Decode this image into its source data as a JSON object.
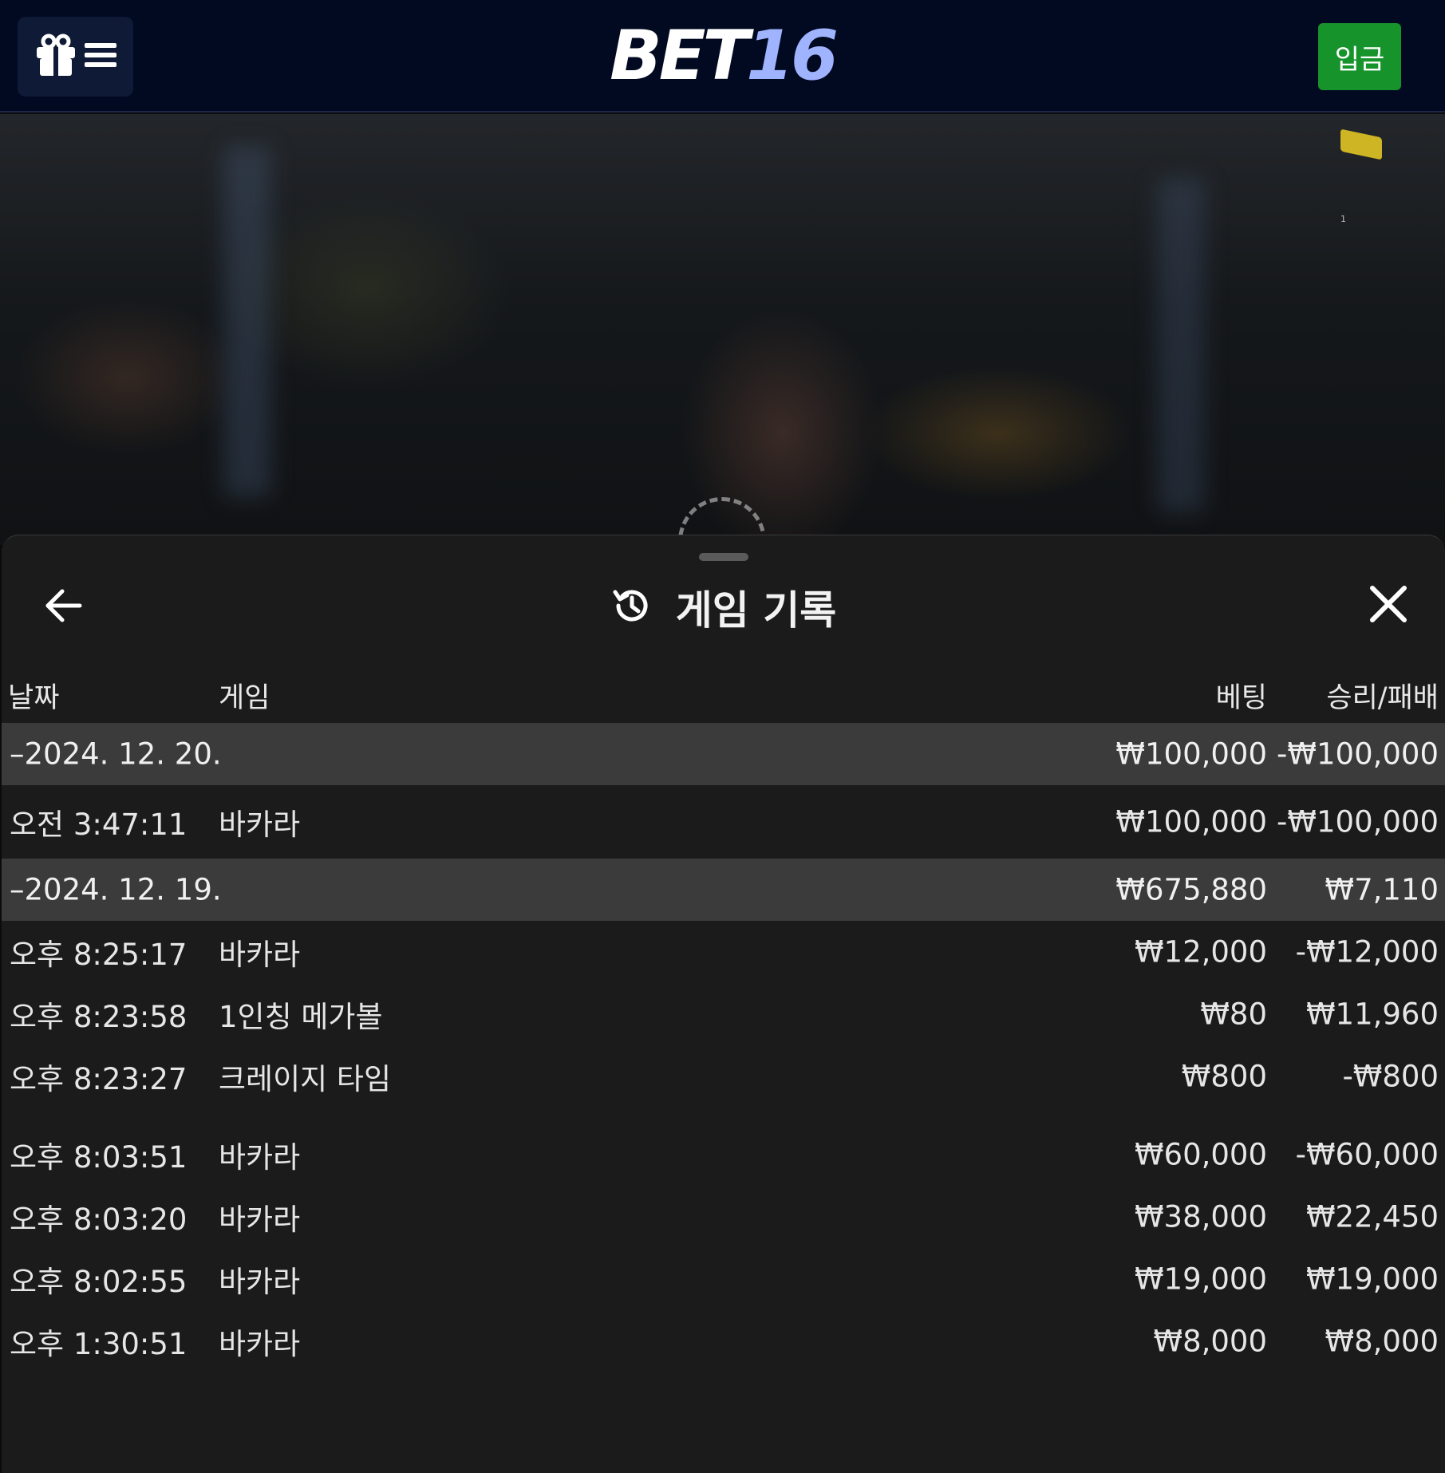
{
  "header": {
    "logo_part1": "BET",
    "logo_part2": "16",
    "deposit_label": "입금",
    "accent_green": "#17932c",
    "logo_accent": "#9fb3ff"
  },
  "video": {
    "corner_mark": "1"
  },
  "sheet": {
    "title": "게임 기록",
    "columns": {
      "date": "날짜",
      "game": "게임",
      "bet": "베팅",
      "result": "승리/패배"
    },
    "groups": [
      {
        "date": "–2024. 12. 20.",
        "bet": "₩100,000",
        "result": "-₩100,000",
        "entries": [
          {
            "time": "오전 3:47:11",
            "game": "바카라",
            "bet": "₩100,000",
            "result": "-₩100,000"
          }
        ]
      },
      {
        "date": "–2024. 12. 19.",
        "bet": "₩675,880",
        "result": "₩7,110",
        "entries": [
          {
            "time": "오후 8:25:17",
            "game": "바카라",
            "bet": "₩12,000",
            "result": "-₩12,000"
          },
          {
            "time": "오후 8:23:58",
            "game": "1인칭 메가볼",
            "bet": "₩80",
            "result": "₩11,960"
          },
          {
            "time": "오후 8:23:27",
            "game": "크레이지 타임",
            "bet": "₩800",
            "result": "-₩800"
          },
          {
            "time": "오후 8:03:51",
            "game": "바카라",
            "bet": "₩60,000",
            "result": "-₩60,000"
          },
          {
            "time": "오후 8:03:20",
            "game": "바카라",
            "bet": "₩38,000",
            "result": "₩22,450"
          },
          {
            "time": "오후 8:02:55",
            "game": "바카라",
            "bet": "₩19,000",
            "result": "₩19,000"
          },
          {
            "time": "오후 1:30:51",
            "game": "바카라",
            "bet": "₩8,000",
            "result": "₩8,000"
          }
        ]
      }
    ]
  }
}
